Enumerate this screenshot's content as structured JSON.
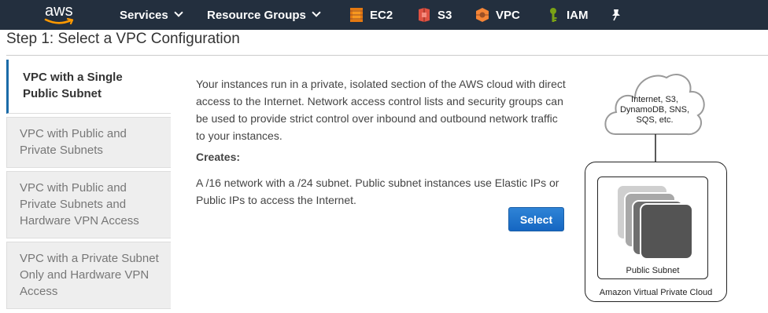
{
  "nav": {
    "logo_text": "aws",
    "services": "Services",
    "resource_groups": "Resource Groups",
    "shortcuts": [
      {
        "label": "EC2",
        "icon": "ec2-icon",
        "color": "#e47911"
      },
      {
        "label": "S3",
        "icon": "s3-icon",
        "color": "#e05243"
      },
      {
        "label": "VPC",
        "icon": "vpc-icon",
        "color": "#f58536"
      },
      {
        "label": "IAM",
        "icon": "iam-icon",
        "color": "#7aa116"
      }
    ],
    "pin_icon": "pin-icon"
  },
  "page": {
    "title": "Step 1: Select a VPC Configuration"
  },
  "tabs": [
    {
      "label": "VPC with a Single Public Subnet",
      "active": true
    },
    {
      "label": "VPC with Public and Private Subnets",
      "active": false
    },
    {
      "label": "VPC with Public and Private Subnets and Hardware VPN Access",
      "active": false
    },
    {
      "label": "VPC with a Private Subnet Only and Hardware VPN Access",
      "active": false
    }
  ],
  "content": {
    "description": "Your instances run in a private, isolated section of the AWS cloud with direct access to the Internet. Network access control lists and security groups can be used to provide strict control over inbound and outbound network traffic to your instances.",
    "creates_label": "Creates:",
    "creates_text": "A /16 network with a /24 subnet. Public subnet instances use Elastic IPs or Public IPs to access the Internet.",
    "select_label": "Select"
  },
  "diagram": {
    "cloud_line1": "Internet, S3,",
    "cloud_line2": "DynamoDB, SNS,",
    "cloud_line3": "SQS, etc.",
    "subnet_label": "Public Subnet",
    "vpc_label": "Amazon Virtual Private Cloud"
  },
  "colors": {
    "nav_bg": "#232f3e",
    "accent": "#1a6ba8",
    "button": "#1566c2"
  }
}
